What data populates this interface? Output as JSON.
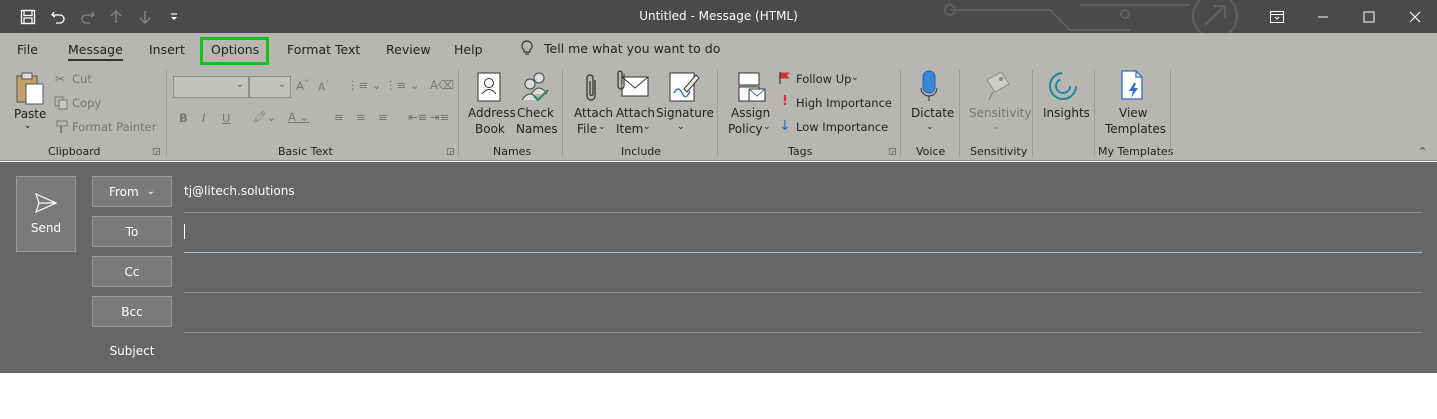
{
  "window": {
    "title": "Untitled  -  Message (HTML)"
  },
  "tabs": [
    {
      "label": "File"
    },
    {
      "label": "Message"
    },
    {
      "label": "Insert"
    },
    {
      "label": "Options"
    },
    {
      "label": "Format Text"
    },
    {
      "label": "Review"
    },
    {
      "label": "Help"
    }
  ],
  "tellme": {
    "text": "Tell me what you want to do"
  },
  "ribbon": {
    "clipboard": {
      "paste": "Paste",
      "cut": "Cut",
      "copy": "Copy",
      "format_painter": "Format Painter",
      "label": "Clipboard"
    },
    "basic_text": {
      "label": "Basic Text"
    },
    "names": {
      "address_book_1": "Address",
      "address_book_2": "Book",
      "check_names_1": "Check",
      "check_names_2": "Names",
      "label": "Names"
    },
    "include": {
      "attach_file_1": "Attach",
      "attach_file_2": "File",
      "attach_item_1": "Attach",
      "attach_item_2": "Item",
      "signature": "Signature",
      "label": "Include"
    },
    "tags": {
      "assign_policy_1": "Assign",
      "assign_policy_2": "Policy",
      "follow_up": "Follow Up",
      "high_importance": "High Importance",
      "low_importance": "Low Importance",
      "label": "Tags"
    },
    "voice": {
      "dictate": "Dictate",
      "label": "Voice"
    },
    "sensitivity": {
      "button": "Sensitivity",
      "label": "Sensitivity"
    },
    "insights": {
      "button": "Insights"
    },
    "templates": {
      "view_1": "View",
      "view_2": "Templates",
      "label": "My Templates"
    }
  },
  "compose": {
    "send": "Send",
    "from_label": "From",
    "from_value": "tj@litech.solutions",
    "to_label": "To",
    "cc_label": "Cc",
    "bcc_label": "Bcc",
    "subject_label": "Subject"
  },
  "colors": {
    "highlight": "#1bbf1b",
    "titlebar": "#4a4a4a",
    "ribbon": "#b8b6b3",
    "compose": "#666666",
    "flag": "#d13438",
    "importance_high": "#d13438",
    "importance_low": "#2b6cc4",
    "insights": "#1a8a9a",
    "templates": "#2b6cc4",
    "dictate": "#2b6cc4"
  }
}
